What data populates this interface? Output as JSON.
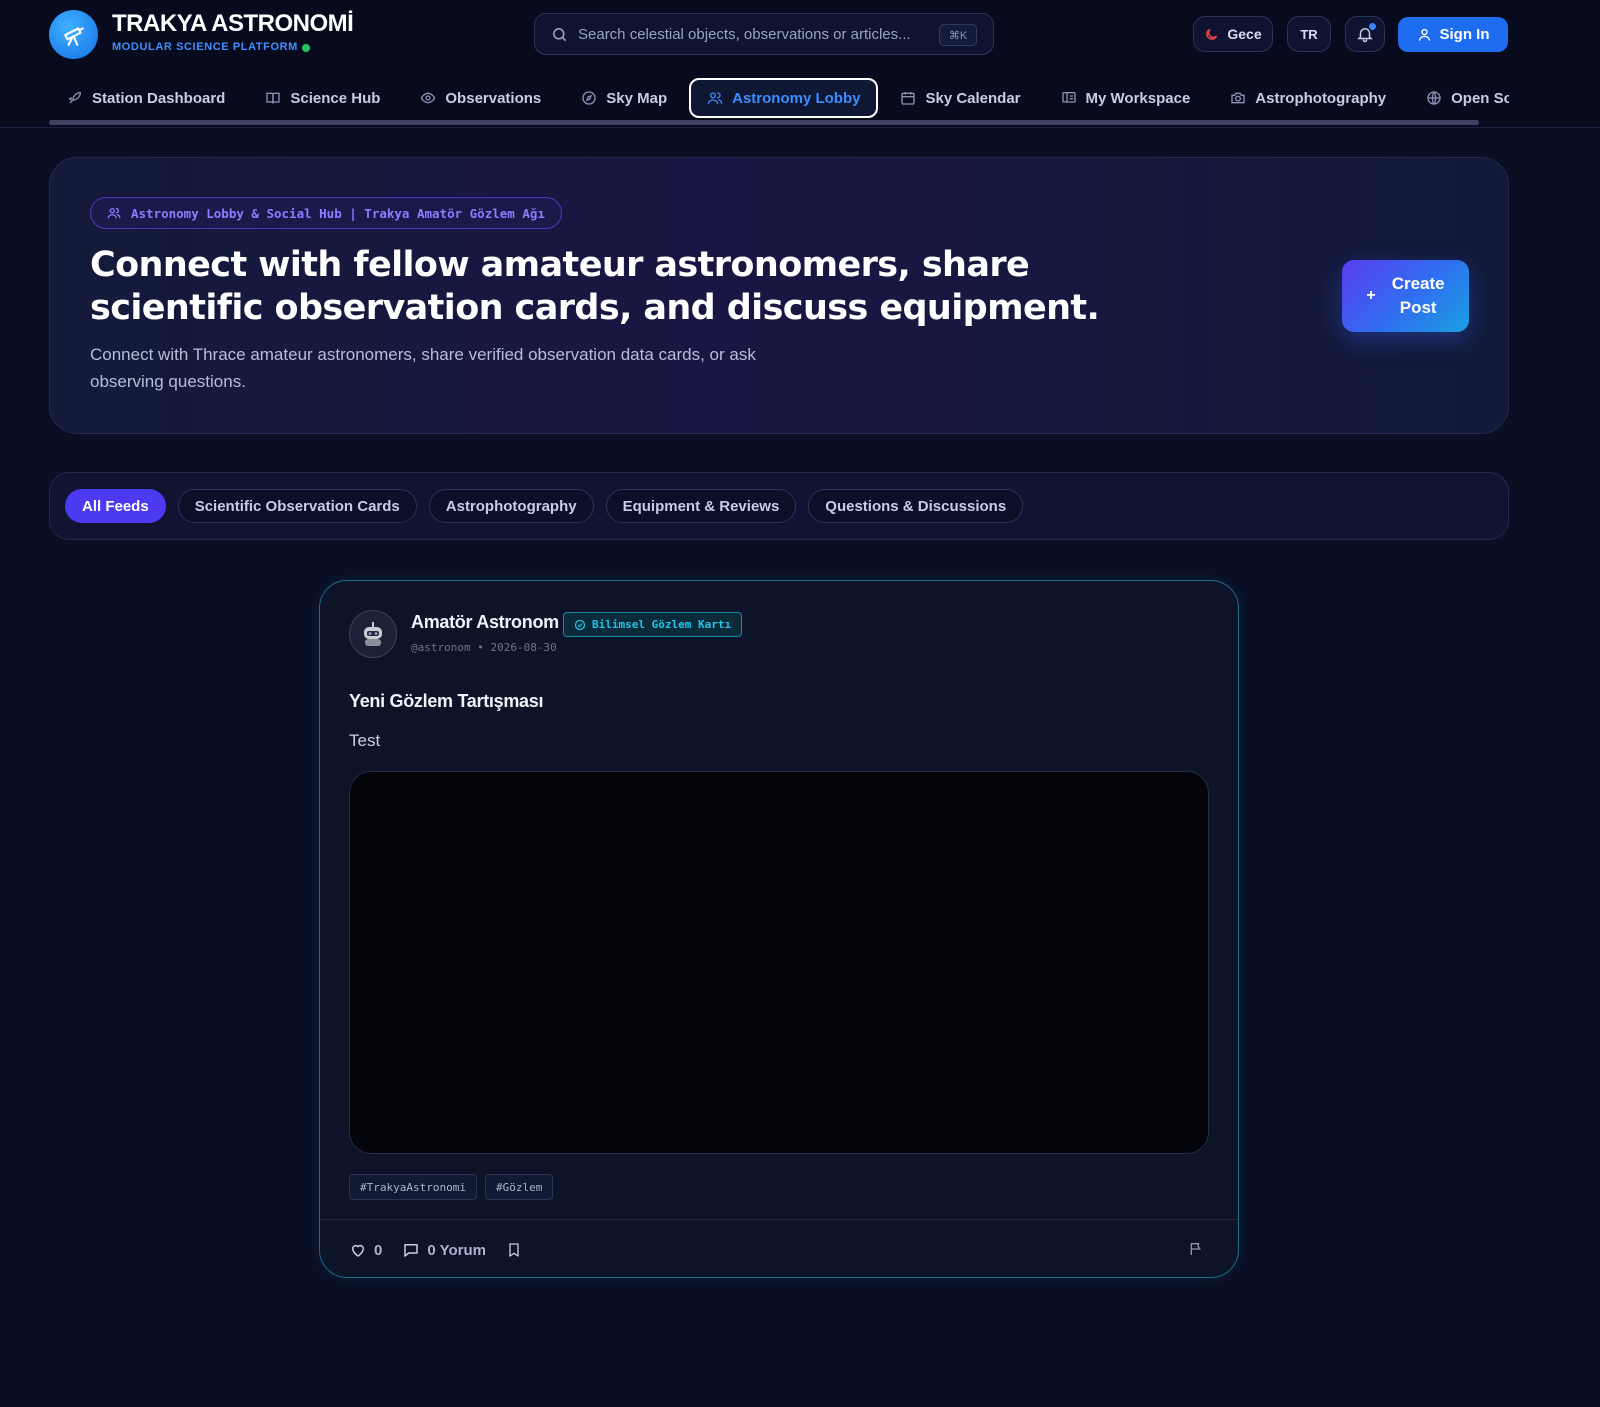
{
  "brand": {
    "title": "TRAKYA ASTRONOMİ",
    "subtitle": "MODULAR SCIENCE PLATFORM",
    "logo_icon": "telescope-icon",
    "status_color": "#22c55e"
  },
  "search": {
    "placeholder": "Search celestial objects, observations or articles...",
    "shortcut": "⌘K"
  },
  "header_actions": {
    "theme_label": "Gece",
    "language_label": "TR",
    "signin_label": "Sign In"
  },
  "nav": {
    "items": [
      {
        "label": "Station Dashboard",
        "icon": "rocket-icon"
      },
      {
        "label": "Science Hub",
        "icon": "book-icon"
      },
      {
        "label": "Observations",
        "icon": "eye-icon"
      },
      {
        "label": "Sky Map",
        "icon": "compass-icon"
      },
      {
        "label": "Astronomy Lobby",
        "icon": "users-icon",
        "active": true
      },
      {
        "label": "Sky Calendar",
        "icon": "calendar-icon"
      },
      {
        "label": "My Workspace",
        "icon": "workspace-icon"
      },
      {
        "label": "Astrophotography",
        "icon": "camera-icon"
      },
      {
        "label": "Open Science Sourc",
        "icon": "globe-icon"
      }
    ]
  },
  "hero": {
    "badge": "Astronomy Lobby & Social Hub | Trakya Amatör Gözlem Ağı",
    "title": "Connect with fellow amateur astronomers, share scientific observation cards, and discuss equipment.",
    "description": "Connect with Thrace amateur astronomers, share verified observation data cards, or ask observing questions.",
    "create_line1": "Create",
    "create_line2": "Post"
  },
  "filters": {
    "items": [
      "All Feeds",
      "Scientific Observation Cards",
      "Astrophotography",
      "Equipment & Reviews",
      "Questions & Discussions"
    ],
    "active_index": 0
  },
  "post": {
    "author": "Amatör Astronom",
    "badge": "Bilimsel Gözlem Kartı",
    "handle": "@astronom • 2026-08-30",
    "title": "Yeni Gözlem Tartışması",
    "body": "Test",
    "tags": [
      "#TrakyaAstronomi",
      "#Gözlem"
    ],
    "likes": "0",
    "comments": "0 Yorum"
  },
  "colors": {
    "accent": "#3b8cff",
    "primary": "#1e6cf0",
    "violet": "#4b3af0",
    "cyan": "#22c5e8",
    "background": "#0a0f24"
  }
}
